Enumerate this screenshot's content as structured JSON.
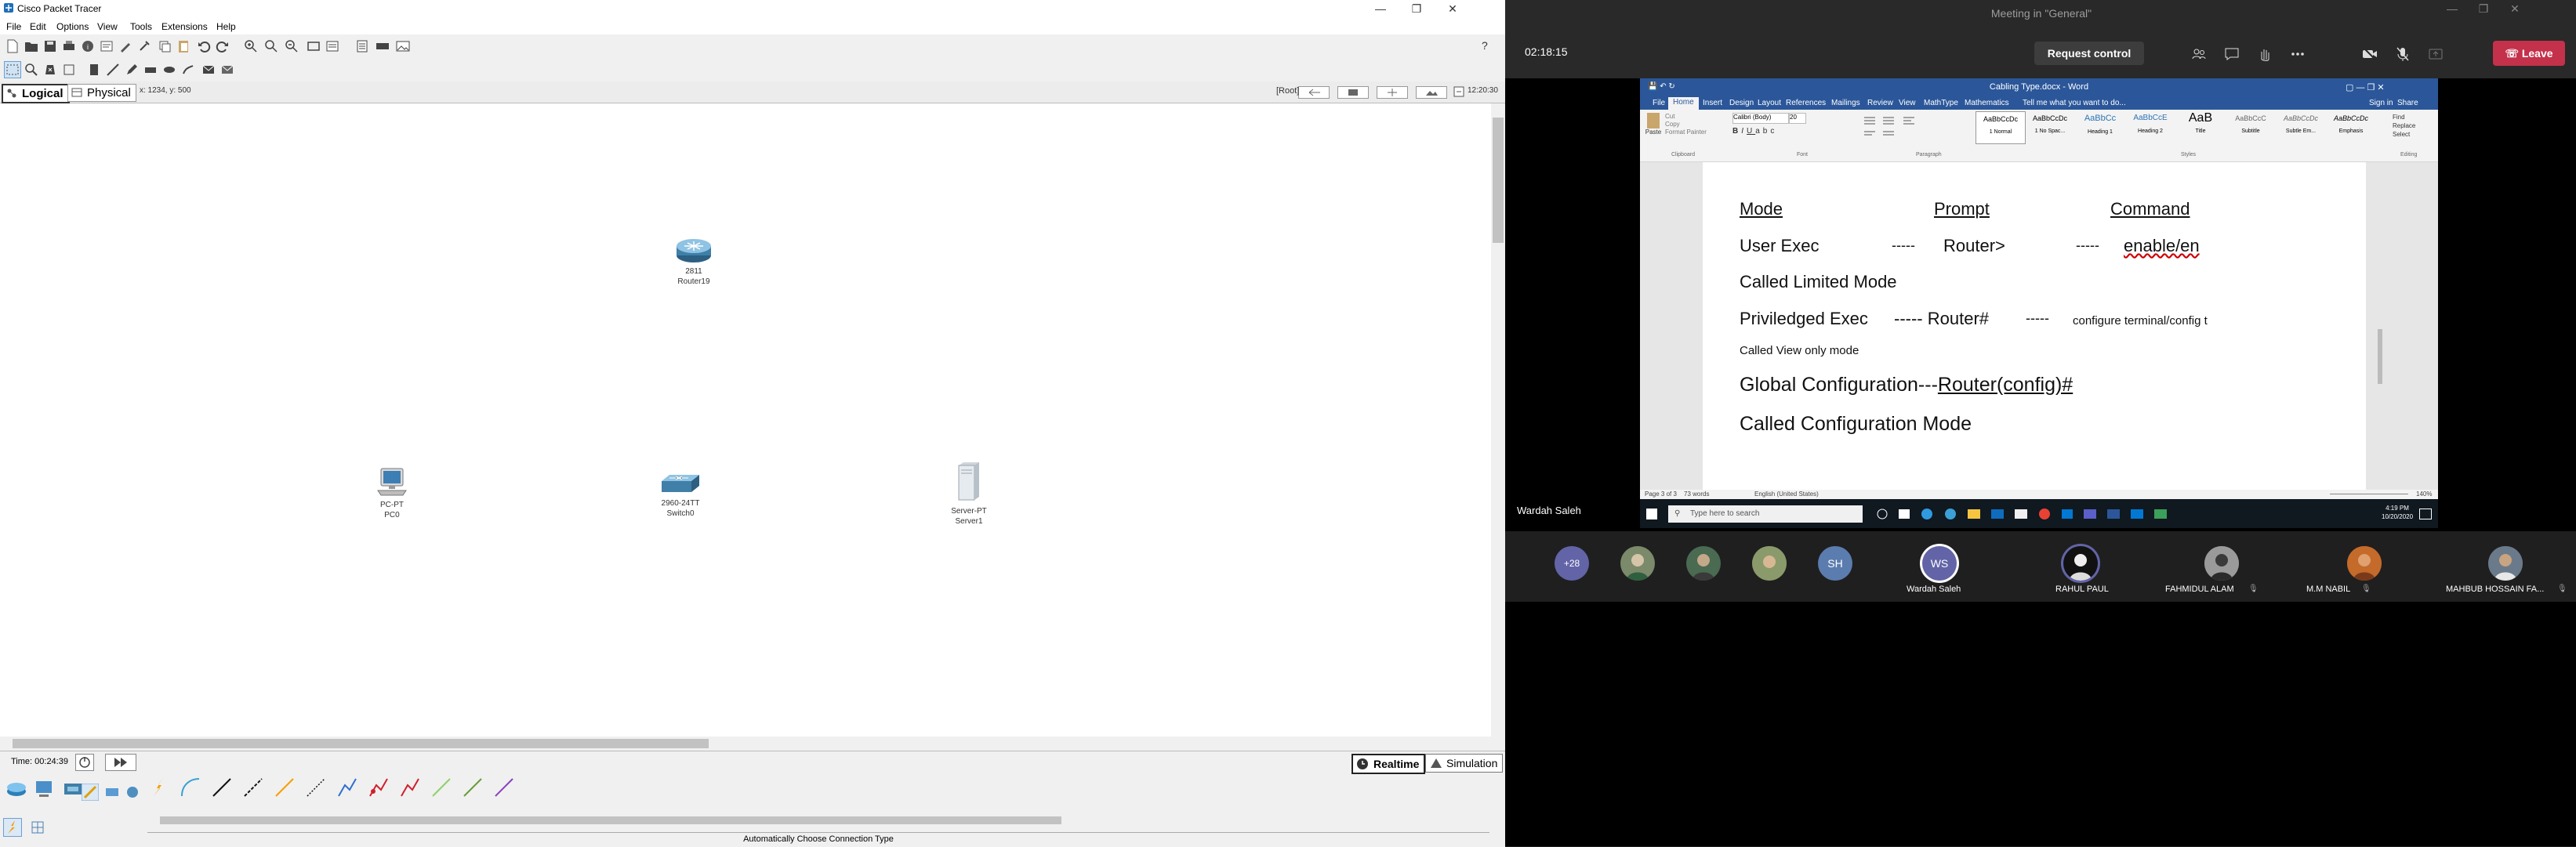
{
  "packet_tracer": {
    "title": "Cisco Packet Tracer",
    "menu": [
      "File",
      "Edit",
      "Options",
      "View",
      "Tools",
      "Extensions",
      "Help"
    ],
    "tabs": {
      "logical": "Logical",
      "physical": "Physical"
    },
    "coords": "x: 1234, y: 500",
    "root_label": "[Root]",
    "clock": "12:20:30",
    "devices": {
      "router": {
        "model": "2811",
        "name": "Router19"
      },
      "pc": {
        "model": "PC-PT",
        "name": "PC0"
      },
      "switch": {
        "model": "2960-24TT",
        "name": "Switch0"
      },
      "server": {
        "model": "Server-PT",
        "name": "Server1"
      }
    },
    "time": "Time: 00:24:39",
    "realtime": "Realtime",
    "simulation": "Simulation",
    "status": "Automatically Choose Connection Type"
  },
  "teams": {
    "title": "Meeting in \"General\"",
    "elapsed": "02:18:15",
    "request_control": "Request control",
    "leave": "Leave",
    "sharer_name": "Wardah Saleh",
    "overflow_count": "+28",
    "participants": [
      {
        "initials": "WS",
        "name": "Wardah Saleh"
      },
      {
        "initials": "",
        "name": "RAHUL PAUL"
      },
      {
        "initials": "",
        "name": "FAHMIDUL ALAM"
      },
      {
        "initials": "",
        "name": "M.M NABIL"
      },
      {
        "initials": "",
        "name": "MAHBUB HOSSAIN FA..."
      }
    ],
    "small_avatar_sh": "SH"
  },
  "word": {
    "title": "Cabling Type.docx - Word",
    "tabs": [
      "File",
      "Home",
      "Insert",
      "Design",
      "Layout",
      "References",
      "Mailings",
      "Review",
      "View",
      "MathType",
      "Mathematics"
    ],
    "tell_me": "Tell me what you want to do...",
    "sign_in": "Sign in",
    "share": "Share",
    "font_name": "Calibri (Body)",
    "font_size": "20",
    "styles": [
      "1 Normal",
      "1 No Spac...",
      "Heading 1",
      "Heading 2",
      "Title",
      "Subtitle",
      "Subtle Em...",
      "Emphasis"
    ],
    "style_previews": [
      "AaBbCcDc",
      "AaBbCcDc",
      "AaBbCc",
      "AaBbCcE",
      "AaB",
      "AaBbCcC",
      "AaBbCcDc",
      "AaBbCcDc"
    ],
    "editing": [
      "Find",
      "Replace",
      "Select"
    ],
    "clipboard": [
      "Cut",
      "Copy",
      "Format Painter"
    ],
    "paste": "Paste",
    "groups": [
      "Clipboard",
      "Font",
      "Paragraph",
      "Styles",
      "Editing"
    ],
    "doc": {
      "h_mode": "Mode",
      "h_prompt": "Prompt",
      "h_command": "Command",
      "r1_mode": "User Exec",
      "r1_d1": "-----",
      "r1_prompt": "Router>",
      "r1_d2": "-----",
      "r1_cmd": "enable/en",
      "r1_note": "Called Limited Mode",
      "r2_mode": "Priviledged Exec",
      "r2_rest": "----- Router#",
      "r2_d2": "-----",
      "r2_cmd": "configure terminal/config t",
      "r2_note": "Called View only mode",
      "r3_a": "Global Configuration---",
      "r3_b": "Router(config)#",
      "r3_note": "Called Configuration Mode"
    },
    "status_page": "Page 3 of 3",
    "status_words": "73 words",
    "status_lang": "English (United States)",
    "zoom": "140%",
    "taskbar_search": "Type here to search",
    "taskbar_time": "4:19 PM",
    "taskbar_date": "10/20/2020"
  }
}
